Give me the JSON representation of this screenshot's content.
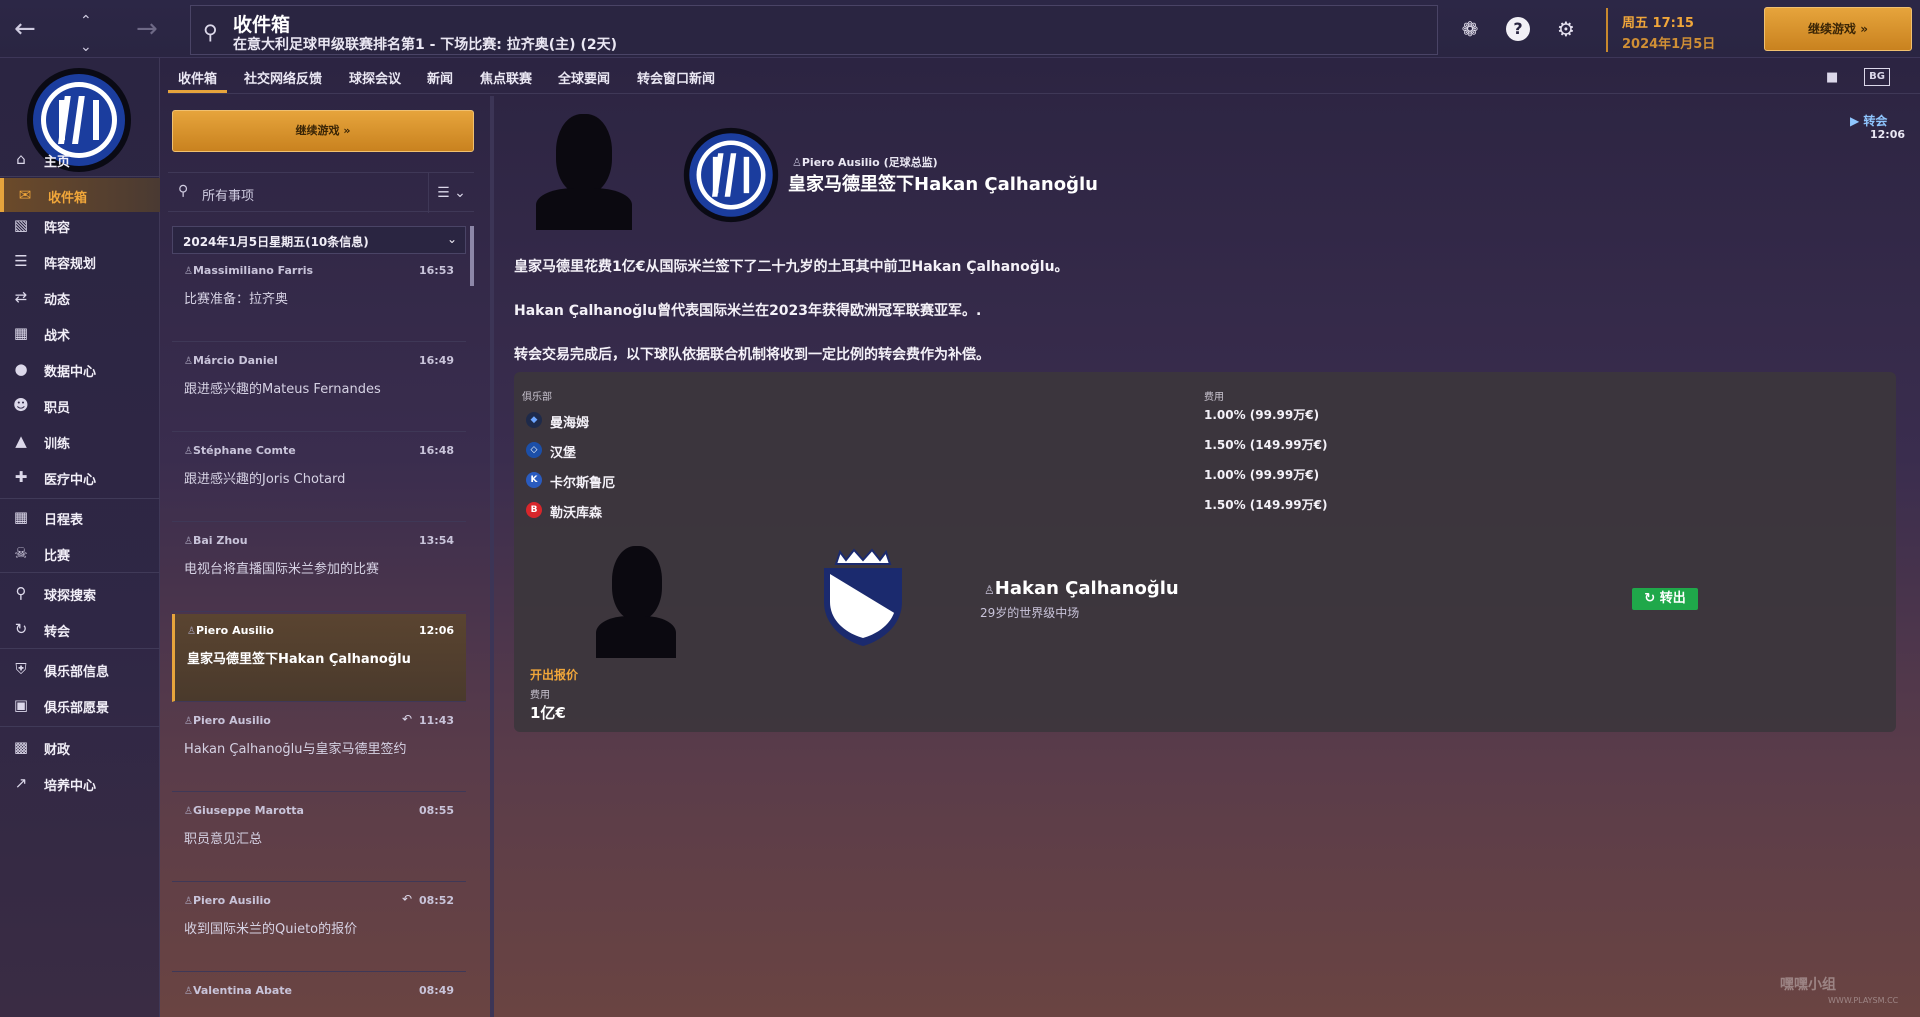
{
  "topbar": {
    "search_title": "收件箱",
    "search_subtitle": "在意大利足球甲级联赛排名第1 - 下场比赛: 拉齐奥(主) (2天)",
    "day_time": "周五 17:15",
    "date": "2024年1月5日",
    "continue_label": "继续游戏",
    "help_glyph": "?"
  },
  "sidebar": {
    "items": [
      {
        "label": "主页",
        "icon": "home-icon"
      },
      {
        "label": "收件箱",
        "icon": "inbox-icon"
      },
      {
        "label": "阵容",
        "icon": "squad-icon"
      },
      {
        "label": "阵容规划",
        "icon": "squad-planner-icon"
      },
      {
        "label": "动态",
        "icon": "dynamics-icon"
      },
      {
        "label": "战术",
        "icon": "tactics-icon"
      },
      {
        "label": "数据中心",
        "icon": "data-hub-icon"
      },
      {
        "label": "职员",
        "icon": "staff-icon"
      },
      {
        "label": "训练",
        "icon": "training-icon"
      },
      {
        "label": "医疗中心",
        "icon": "medical-icon"
      },
      {
        "label": "日程表",
        "icon": "schedule-icon"
      },
      {
        "label": "比赛",
        "icon": "trophy-icon"
      },
      {
        "label": "球探搜索",
        "icon": "scouting-icon"
      },
      {
        "label": "转会",
        "icon": "transfers-icon"
      },
      {
        "label": "俱乐部信息",
        "icon": "club-info-icon"
      },
      {
        "label": "俱乐部愿景",
        "icon": "club-vision-icon"
      },
      {
        "label": "财政",
        "icon": "finances-icon"
      },
      {
        "label": "培养中心",
        "icon": "development-icon"
      }
    ]
  },
  "tabs": [
    "收件箱",
    "社交网络反馈",
    "球探会议",
    "新闻",
    "焦点联赛",
    "全球要闻",
    "转会窗口新闻"
  ],
  "header_tools": {
    "bg_label": "BG"
  },
  "inbox": {
    "continue_label": "继续游戏",
    "filter_placeholder": "所有事项",
    "date_header": "2024年1月5日星期五(10条信息)",
    "messages": [
      {
        "sender": "Massimiliano Farris",
        "time": "16:53",
        "subject": "比赛准备：拉齐奥"
      },
      {
        "sender": "Márcio Daniel",
        "time": "16:49",
        "subject": "跟进感兴趣的Mateus Fernandes"
      },
      {
        "sender": "Stéphane Comte",
        "time": "16:48",
        "subject": "跟进感兴趣的Joris Chotard"
      },
      {
        "sender": "Bai Zhou",
        "time": "13:54",
        "subject": "电视台将直播国际米兰参加的比赛"
      },
      {
        "sender": "Piero Ausilio",
        "time": "12:06",
        "subject": "皇家马德里签下Hakan Çalhanoğlu"
      },
      {
        "sender": "Piero Ausilio",
        "time": "11:43",
        "subject": "Hakan Çalhanoğlu与皇家马德里签约"
      },
      {
        "sender": "Giuseppe Marotta",
        "time": "08:55",
        "subject": "职员意见汇总"
      },
      {
        "sender": "Piero Ausilio",
        "time": "08:52",
        "subject": "收到国际米兰的Quieto的报价"
      },
      {
        "sender": "Valentina Abate",
        "time": "08:49",
        "subject": ""
      }
    ]
  },
  "message": {
    "sender": "Piero Ausilio (足球总监)",
    "headline": "皇家马德里签下Hakan Çalhanoğlu",
    "tag": "转会",
    "time": "12:06",
    "paragraph1": "皇家马德里花费1亿€从国际米兰签下了二十九岁的土耳其中前卫Hakan Çalhanoğlu。",
    "paragraph2": "Hakan Çalhanoğlu曾代表国际米兰在2023年获得欧洲冠军联赛亚军。.",
    "paragraph3": "转会交易完成后，以下球队依据联合机制将收到一定比例的转会费作为补偿。",
    "table": {
      "col_club": "俱乐部",
      "col_fee": "费用",
      "rows": [
        {
          "club": "曼海姆",
          "fee": "1.00% (99.99万€)",
          "color": "#3a6fd8"
        },
        {
          "club": "汉堡",
          "fee": "1.50% (149.99万€)",
          "color": "#1c4fa8"
        },
        {
          "club": "卡尔斯鲁厄",
          "fee": "1.00% (99.99万€)",
          "color": "#2a5bbf"
        },
        {
          "club": "勒沃库森",
          "fee": "1.50% (149.99万€)",
          "color": "#d8262b"
        }
      ]
    },
    "player": {
      "name": "Hakan Çalhanoğlu",
      "desc": "29岁的世界级中场",
      "status": "转出"
    },
    "offer_label": "开出报价",
    "fee_label": "费用",
    "fee_value": "1亿€"
  },
  "watermark": {
    "text": "嘿嘿小组",
    "url": "WWW.PLAYSM.CC"
  },
  "colors": {
    "accent": "#e6a43c",
    "out_badge": "#1fa84a",
    "tag": "#8fc6ff"
  }
}
